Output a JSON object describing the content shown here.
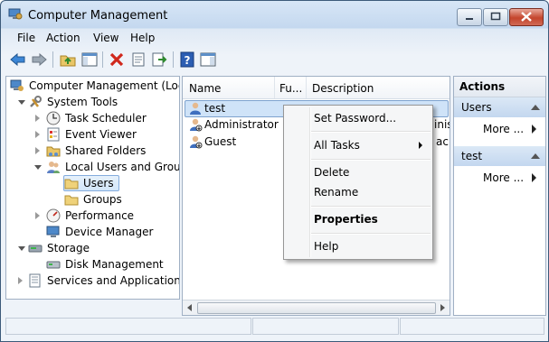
{
  "window": {
    "title": "Computer Management"
  },
  "menubar": {
    "file": "File",
    "action": "Action",
    "view": "View",
    "help": "Help"
  },
  "tree": {
    "root": "Computer Management (Local",
    "system_tools": "System Tools",
    "task_scheduler": "Task Scheduler",
    "event_viewer": "Event Viewer",
    "shared_folders": "Shared Folders",
    "local_users_groups": "Local Users and Groups",
    "users": "Users",
    "groups": "Groups",
    "performance": "Performance",
    "device_manager": "Device Manager",
    "storage": "Storage",
    "disk_management": "Disk Management",
    "services_apps": "Services and Applications"
  },
  "list": {
    "columns": {
      "name": "Name",
      "full_name": "Fu...",
      "description": "Description"
    },
    "rows": [
      {
        "name": "test",
        "description": ""
      },
      {
        "name": "Administrator",
        "description": "inist"
      },
      {
        "name": "Guest",
        "description": "ac"
      }
    ]
  },
  "actions": {
    "header": "Actions",
    "section1": {
      "title": "Users",
      "more": "More ..."
    },
    "section2": {
      "title": "test",
      "more": "More ..."
    }
  },
  "context_menu": {
    "set_password": "Set Password...",
    "all_tasks": "All Tasks",
    "delete": "Delete",
    "rename": "Rename",
    "properties": "Properties",
    "help": "Help"
  },
  "colors": {
    "accent": "#3a76c4",
    "selection": "#d2e6f9",
    "close": "#c4452c"
  }
}
